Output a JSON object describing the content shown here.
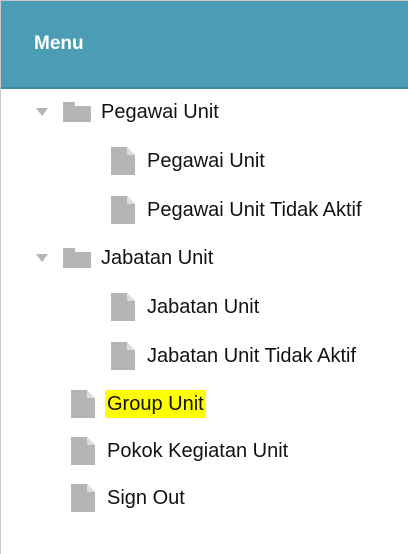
{
  "header": {
    "title": "Menu"
  },
  "tree": {
    "pegawai_group": {
      "label": "Pegawai Unit",
      "children": [
        {
          "label": "Pegawai Unit"
        },
        {
          "label": "Pegawai Unit Tidak Aktif"
        }
      ]
    },
    "jabatan_group": {
      "label": "Jabatan Unit",
      "children": [
        {
          "label": "Jabatan Unit"
        },
        {
          "label": "Jabatan Unit Tidak Aktif"
        }
      ]
    },
    "items": [
      {
        "label": "Group Unit",
        "highlighted": true
      },
      {
        "label": "Pokok Kegiatan Unit"
      },
      {
        "label": "Sign Out"
      }
    ]
  },
  "colors": {
    "header_bg": "#4a9db5",
    "highlight": "#ffff00",
    "icon": "#b5b5b5"
  },
  "icons": {
    "expanded": "triangle-down-icon",
    "folder": "folder-icon",
    "file": "document-icon"
  }
}
